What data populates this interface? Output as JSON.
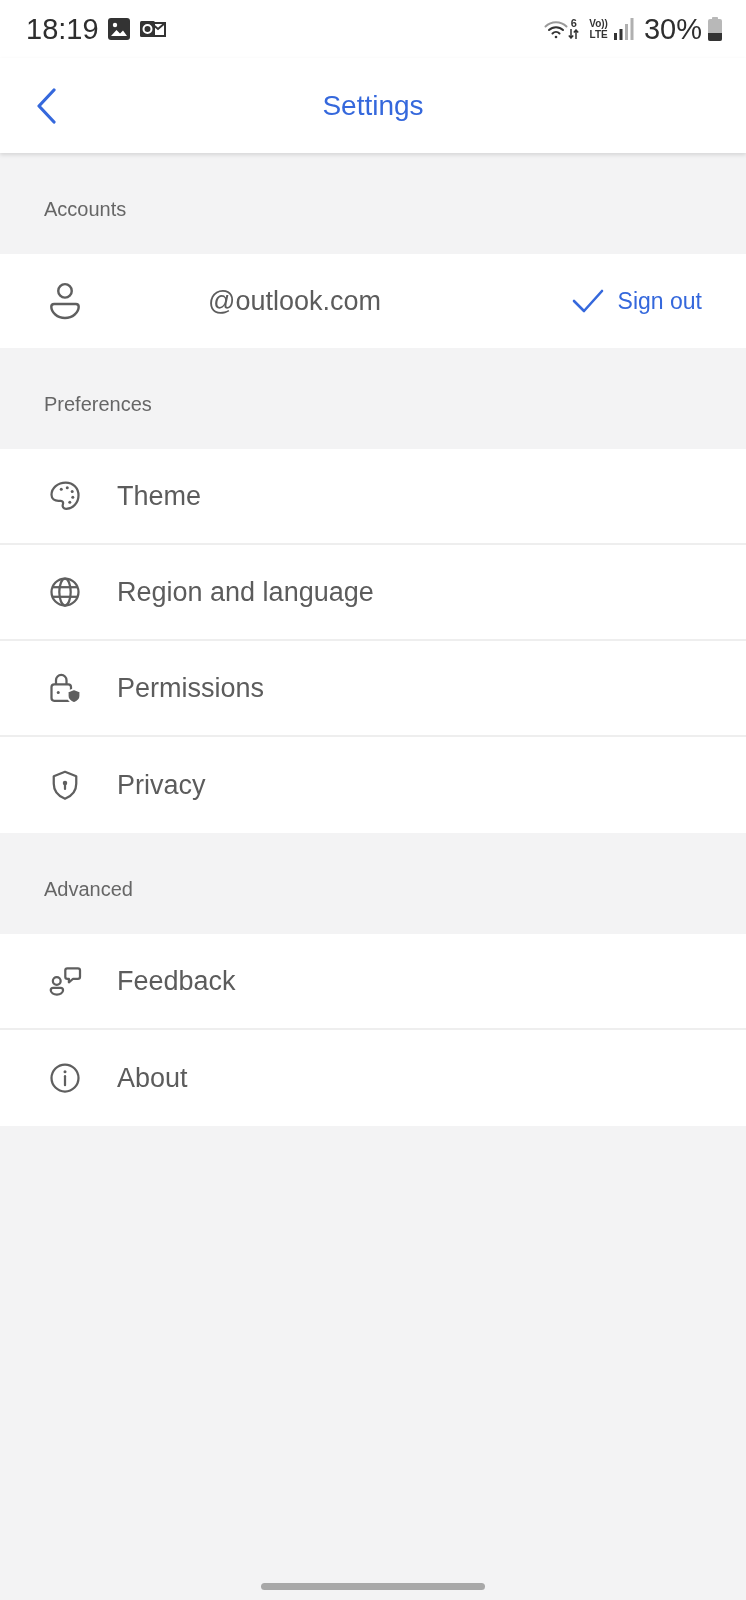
{
  "status_bar": {
    "time": "18:19",
    "wifi_badge": "6",
    "volte_top": "Vo))",
    "volte_bottom": "LTE",
    "battery": "30%"
  },
  "header": {
    "title": "Settings"
  },
  "sections": [
    {
      "title": "Accounts",
      "items": [
        {
          "kind": "account",
          "label": "@outlook.com",
          "action": "Sign out"
        }
      ]
    },
    {
      "title": "Preferences",
      "items": [
        {
          "kind": "link",
          "label": "Theme"
        },
        {
          "kind": "link",
          "label": "Region and language"
        },
        {
          "kind": "link",
          "label": "Permissions"
        },
        {
          "kind": "link",
          "label": "Privacy"
        }
      ]
    },
    {
      "title": "Advanced",
      "items": [
        {
          "kind": "link",
          "label": "Feedback"
        },
        {
          "kind": "link",
          "label": "About"
        }
      ]
    }
  ]
}
